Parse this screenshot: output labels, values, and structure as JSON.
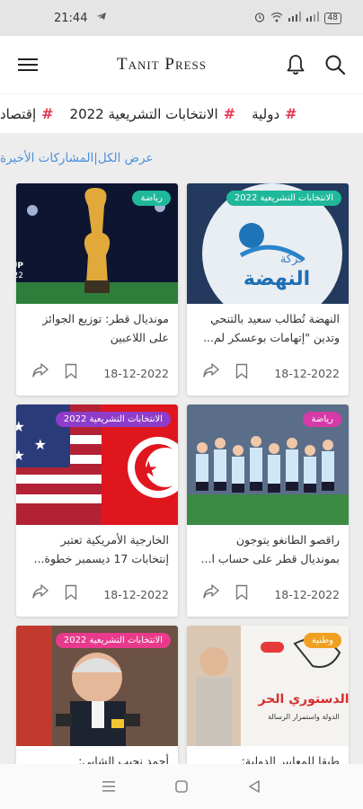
{
  "status": {
    "time": "21:44",
    "battery": "48"
  },
  "app": {
    "title": "Tanit Press"
  },
  "tags": [
    {
      "label": "دولية"
    },
    {
      "label": "الانتخابات التشريعية 2022"
    },
    {
      "label": "إقتصاد"
    }
  ],
  "section": {
    "title": "عرض الكل|المشاركات الأخيرة"
  },
  "cards": [
    {
      "badge": "الانتخابات التشريعية 2022",
      "badge_color": "#1fb89a",
      "title": "النهضة تُطالب سعيد بالتنحي وتدين \"إتهامات بوعسكر لم...",
      "date": "18-12-2022"
    },
    {
      "badge": "رياضة",
      "badge_color": "#1fb89a",
      "title": "مونديال قطر: توزيع الجوائز على اللاعبين",
      "date": "18-12-2022"
    },
    {
      "badge": "رياضة",
      "badge_color": "#d63aa8",
      "title": "راقصو الطانغو يتوجون بمونديال قطر على حساب ا...",
      "date": "18-12-2022"
    },
    {
      "badge": "الانتخابات التشريعية 2022",
      "badge_color": "#8e3cc9",
      "title": "الخارجية الأمريكية تعتبر إنتخابات 17 ديسمبر خطوة...",
      "date": "18-12-2022"
    },
    {
      "badge": "وطنية",
      "badge_color": "#f0a020",
      "title": "طبقا للمعايير الدولية:",
      "date": ""
    },
    {
      "badge": "الانتخابات التشريعية 2022",
      "badge_color": "#e83a8c",
      "title": "أحمد نجيب الشابي:",
      "date": ""
    }
  ]
}
